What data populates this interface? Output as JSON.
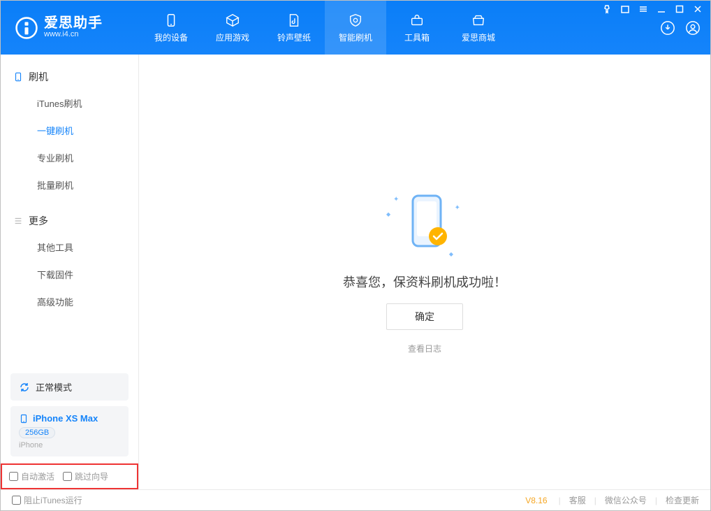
{
  "app": {
    "name_cn": "爱思助手",
    "name_en": "www.i4.cn"
  },
  "nav": {
    "items": [
      {
        "label": "我的设备"
      },
      {
        "label": "应用游戏"
      },
      {
        "label": "铃声壁纸"
      },
      {
        "label": "智能刷机"
      },
      {
        "label": "工具箱"
      },
      {
        "label": "爱思商城"
      }
    ]
  },
  "sidebar": {
    "group1": {
      "title": "刷机"
    },
    "items1": [
      {
        "label": "iTunes刷机"
      },
      {
        "label": "一键刷机"
      },
      {
        "label": "专业刷机"
      },
      {
        "label": "批量刷机"
      }
    ],
    "group2": {
      "title": "更多"
    },
    "items2": [
      {
        "label": "其他工具"
      },
      {
        "label": "下载固件"
      },
      {
        "label": "高级功能"
      }
    ],
    "mode_label": "正常模式",
    "device": {
      "name": "iPhone XS Max",
      "capacity": "256GB",
      "type": "iPhone"
    },
    "opts": {
      "auto_activate": "自动激活",
      "skip_guide": "跳过向导"
    }
  },
  "main": {
    "success_msg": "恭喜您，保资料刷机成功啦！",
    "ok_btn": "确定",
    "view_log": "查看日志"
  },
  "footer": {
    "block_itunes": "阻止iTunes运行",
    "version": "V8.16",
    "links": {
      "support": "客服",
      "wechat": "微信公众号",
      "update": "检查更新"
    }
  }
}
